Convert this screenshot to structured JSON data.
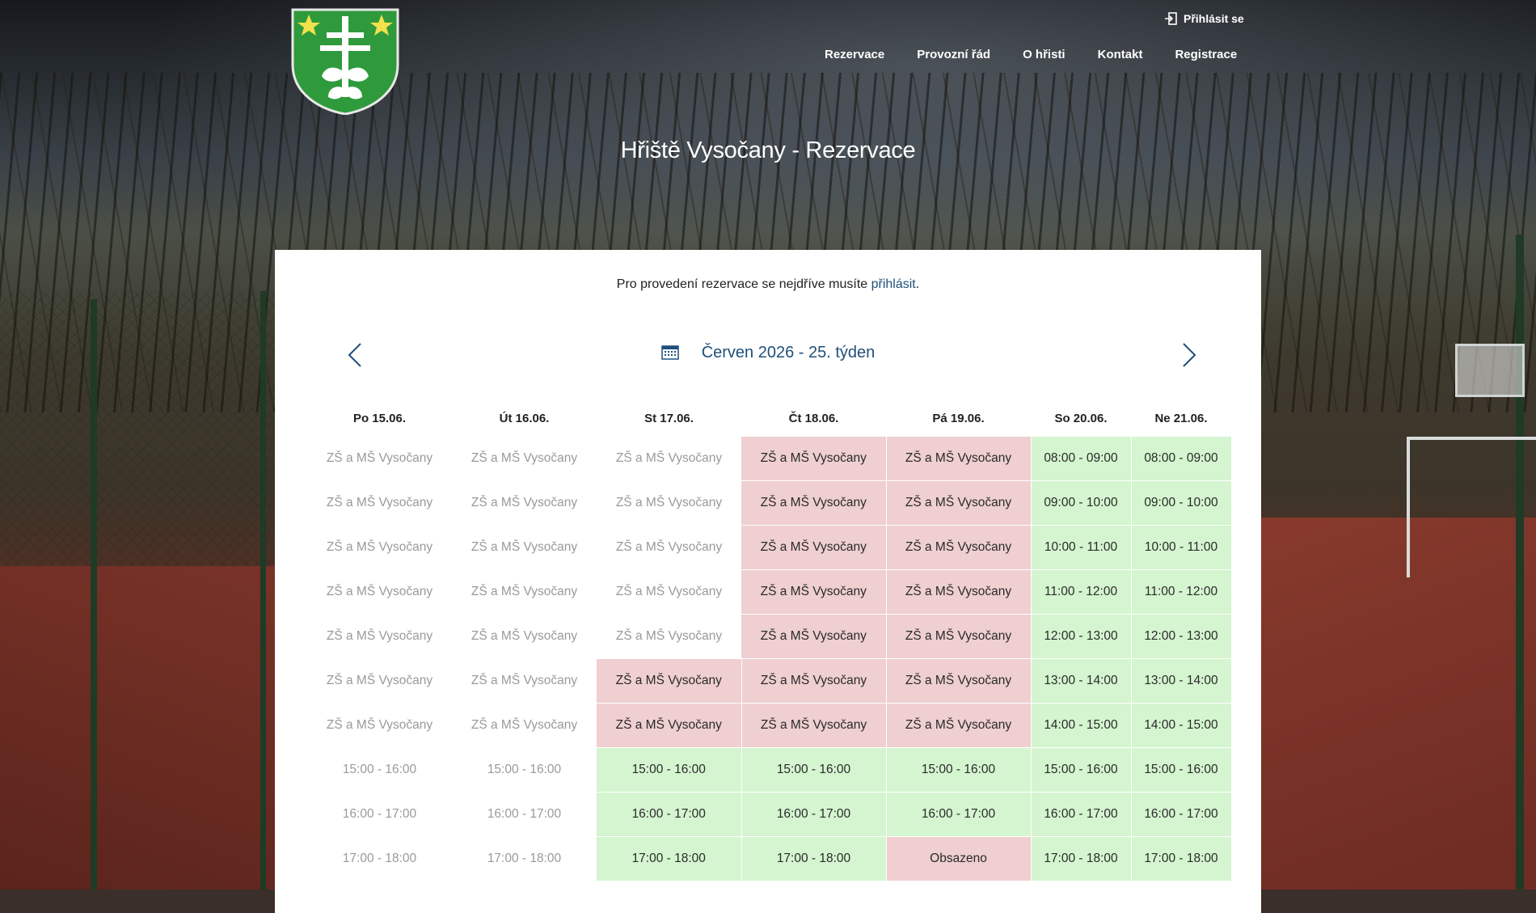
{
  "header": {
    "login_label": "Přihlásit se",
    "nav": [
      "Rezervace",
      "Provozní řád",
      "O hřisti",
      "Kontakt",
      "Registrace"
    ],
    "title": "Hřiště Vysočany - Rezervace"
  },
  "notice": {
    "text": "Pro provedení rezervace se nejdříve musíte ",
    "link": "přihlásit",
    "suffix": "."
  },
  "week": {
    "label": "Červen 2026 - 25. týden"
  },
  "colors": {
    "booked": "#efcfd0",
    "free": "#d4f5cf",
    "link": "#1f4f7a"
  },
  "schedule": {
    "days": [
      "Po 15.06.",
      "Út 16.06.",
      "St 17.06.",
      "Čt 18.06.",
      "Pá 19.06.",
      "So 20.06.",
      "Ne 21.06."
    ],
    "rows": [
      [
        {
          "t": "ZŠ a MŠ Vysočany",
          "s": "past"
        },
        {
          "t": "ZŠ a MŠ Vysočany",
          "s": "past"
        },
        {
          "t": "ZŠ a MŠ Vysočany",
          "s": "past"
        },
        {
          "t": "ZŠ a MŠ Vysočany",
          "s": "booked"
        },
        {
          "t": "ZŠ a MŠ Vysočany",
          "s": "booked"
        },
        {
          "t": "08:00 - 09:00",
          "s": "free"
        },
        {
          "t": "08:00 - 09:00",
          "s": "free"
        }
      ],
      [
        {
          "t": "ZŠ a MŠ Vysočany",
          "s": "past"
        },
        {
          "t": "ZŠ a MŠ Vysočany",
          "s": "past"
        },
        {
          "t": "ZŠ a MŠ Vysočany",
          "s": "past"
        },
        {
          "t": "ZŠ a MŠ Vysočany",
          "s": "booked"
        },
        {
          "t": "ZŠ a MŠ Vysočany",
          "s": "booked"
        },
        {
          "t": "09:00 - 10:00",
          "s": "free"
        },
        {
          "t": "09:00 - 10:00",
          "s": "free"
        }
      ],
      [
        {
          "t": "ZŠ a MŠ Vysočany",
          "s": "past"
        },
        {
          "t": "ZŠ a MŠ Vysočany",
          "s": "past"
        },
        {
          "t": "ZŠ a MŠ Vysočany",
          "s": "past"
        },
        {
          "t": "ZŠ a MŠ Vysočany",
          "s": "booked"
        },
        {
          "t": "ZŠ a MŠ Vysočany",
          "s": "booked"
        },
        {
          "t": "10:00 - 11:00",
          "s": "free"
        },
        {
          "t": "10:00 - 11:00",
          "s": "free"
        }
      ],
      [
        {
          "t": "ZŠ a MŠ Vysočany",
          "s": "past"
        },
        {
          "t": "ZŠ a MŠ Vysočany",
          "s": "past"
        },
        {
          "t": "ZŠ a MŠ Vysočany",
          "s": "past"
        },
        {
          "t": "ZŠ a MŠ Vysočany",
          "s": "booked"
        },
        {
          "t": "ZŠ a MŠ Vysočany",
          "s": "booked"
        },
        {
          "t": "11:00 - 12:00",
          "s": "free"
        },
        {
          "t": "11:00 - 12:00",
          "s": "free"
        }
      ],
      [
        {
          "t": "ZŠ a MŠ Vysočany",
          "s": "past"
        },
        {
          "t": "ZŠ a MŠ Vysočany",
          "s": "past"
        },
        {
          "t": "ZŠ a MŠ Vysočany",
          "s": "past"
        },
        {
          "t": "ZŠ a MŠ Vysočany",
          "s": "booked"
        },
        {
          "t": "ZŠ a MŠ Vysočany",
          "s": "booked"
        },
        {
          "t": "12:00 - 13:00",
          "s": "free"
        },
        {
          "t": "12:00 - 13:00",
          "s": "free"
        }
      ],
      [
        {
          "t": "ZŠ a MŠ Vysočany",
          "s": "past"
        },
        {
          "t": "ZŠ a MŠ Vysočany",
          "s": "past"
        },
        {
          "t": "ZŠ a MŠ Vysočany",
          "s": "booked"
        },
        {
          "t": "ZŠ a MŠ Vysočany",
          "s": "booked"
        },
        {
          "t": "ZŠ a MŠ Vysočany",
          "s": "booked"
        },
        {
          "t": "13:00 - 14:00",
          "s": "free"
        },
        {
          "t": "13:00 - 14:00",
          "s": "free"
        }
      ],
      [
        {
          "t": "ZŠ a MŠ Vysočany",
          "s": "past"
        },
        {
          "t": "ZŠ a MŠ Vysočany",
          "s": "past"
        },
        {
          "t": "ZŠ a MŠ Vysočany",
          "s": "booked"
        },
        {
          "t": "ZŠ a MŠ Vysočany",
          "s": "booked"
        },
        {
          "t": "ZŠ a MŠ Vysočany",
          "s": "booked"
        },
        {
          "t": "14:00 - 15:00",
          "s": "free"
        },
        {
          "t": "14:00 - 15:00",
          "s": "free"
        }
      ],
      [
        {
          "t": "15:00 - 16:00",
          "s": "past"
        },
        {
          "t": "15:00 - 16:00",
          "s": "past"
        },
        {
          "t": "15:00 - 16:00",
          "s": "free"
        },
        {
          "t": "15:00 - 16:00",
          "s": "free"
        },
        {
          "t": "15:00 - 16:00",
          "s": "free"
        },
        {
          "t": "15:00 - 16:00",
          "s": "free"
        },
        {
          "t": "15:00 - 16:00",
          "s": "free"
        }
      ],
      [
        {
          "t": "16:00 - 17:00",
          "s": "past"
        },
        {
          "t": "16:00 - 17:00",
          "s": "past"
        },
        {
          "t": "16:00 - 17:00",
          "s": "free"
        },
        {
          "t": "16:00 - 17:00",
          "s": "free"
        },
        {
          "t": "16:00 - 17:00",
          "s": "free"
        },
        {
          "t": "16:00 - 17:00",
          "s": "free"
        },
        {
          "t": "16:00 - 17:00",
          "s": "free"
        }
      ],
      [
        {
          "t": "17:00 - 18:00",
          "s": "past"
        },
        {
          "t": "17:00 - 18:00",
          "s": "past"
        },
        {
          "t": "17:00 - 18:00",
          "s": "free"
        },
        {
          "t": "17:00 - 18:00",
          "s": "free"
        },
        {
          "t": "Obsazeno",
          "s": "occupied"
        },
        {
          "t": "17:00 - 18:00",
          "s": "free"
        },
        {
          "t": "17:00 - 18:00",
          "s": "free"
        }
      ]
    ]
  }
}
